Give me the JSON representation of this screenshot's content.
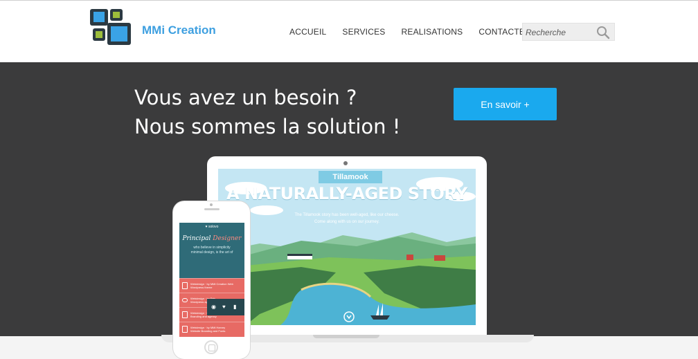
{
  "brand": {
    "name": "MMi Creation",
    "logo_colors": {
      "frame": "#2b3942",
      "blue": "#3aa3e6",
      "green": "#9dbd3b"
    }
  },
  "nav": {
    "items": [
      {
        "label": "ACCUEIL"
      },
      {
        "label": "SERVICES"
      },
      {
        "label": "REALISATIONS"
      },
      {
        "label": "CONTACTEZ-NOUS"
      }
    ]
  },
  "search": {
    "placeholder": "Recherche",
    "icon": "search-icon"
  },
  "hero": {
    "title_line1": "Vous avez un besoin ?",
    "title_line2": "Nous sommes la solution !",
    "cta_label": "En savoir +",
    "background": "#3b3b3c",
    "accent": "#1aa9ee"
  },
  "laptop_screen": {
    "banner": "Tillamook",
    "headline": "A NATURALLY-AGED STORY",
    "subline1": "The Tillamook story has been well-aged, like our cheese.",
    "subline2": "Come along with us on our journey.",
    "scroll_icon": "chevron-down-icon"
  },
  "phone_screen": {
    "logo": "♥ solovo",
    "title_a": "Principal",
    "title_b": "Designer",
    "sub1": "who believe in simplicity",
    "sub2": "minimal design, is the art of",
    "rows": [
      {
        "line1": "Webdesign · by MMi Creation Web",
        "line2": "Wordpress theme"
      },
      {
        "line1": "Webdesign · by Fab",
        "line2": "Wordpress app · Dribbble"
      },
      {
        "line1": "Webdesign · by MMi",
        "line2": "Branding and agency"
      },
      {
        "line1": "Webdesign · by MMi Harvey",
        "line2": "Website Branding and Fonts"
      }
    ]
  }
}
